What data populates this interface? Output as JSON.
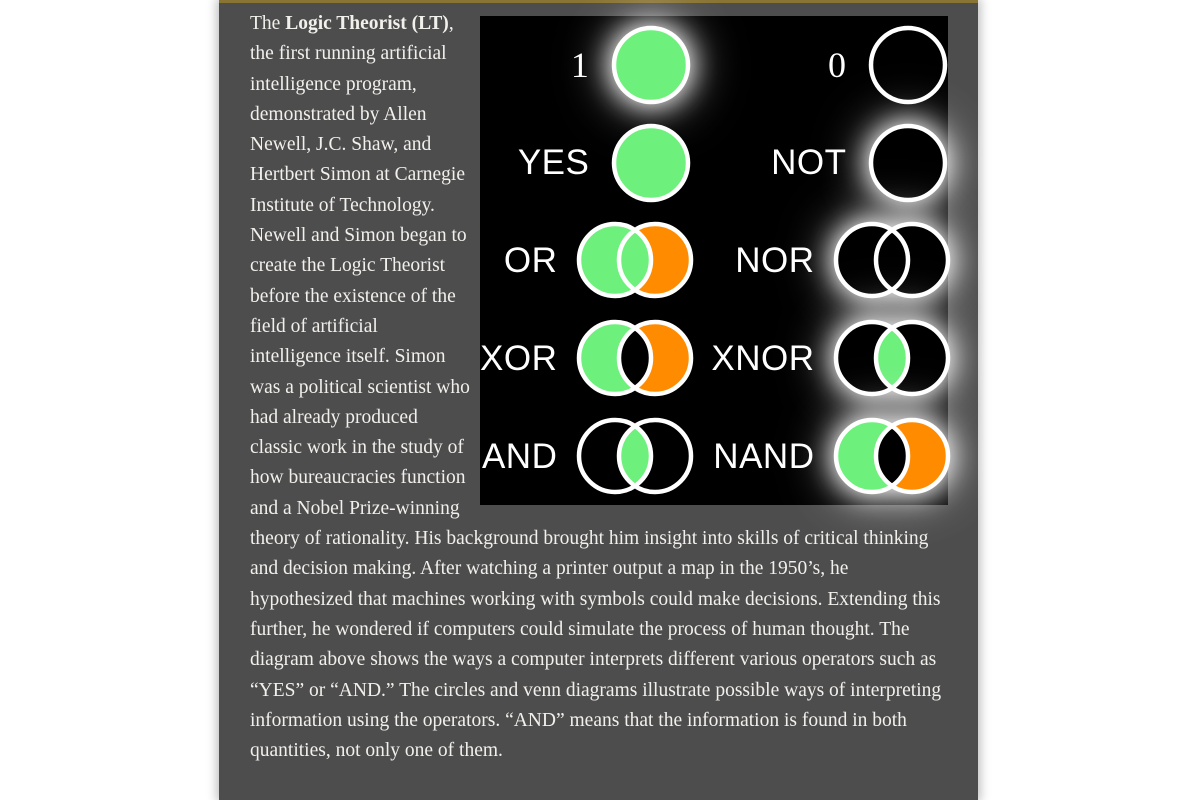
{
  "theme": {
    "page_background": "#ffffff",
    "article_background": "#4d4d4d",
    "top_rule": "#8a7434",
    "text_color": "#f2f0ec",
    "figure_background": "#000000",
    "on_color": "#6ef07d",
    "alt_color": "#ff8c00",
    "outline_color": "#ffffff",
    "glow_color": "#ffffff"
  },
  "article": {
    "intro": {
      "lead_prefix": "The ",
      "lead_bold": "Logic Theorist (LT)",
      "lead_rest": ", the first running artificial intelligence program, demonstrated by Allen Newell, J.C. Shaw, and Hertbert Simon at Carnegie Institute of Technology."
    },
    "body": "Newell and Simon began to create the Logic Theorist before the existence of the field of artificial intelligence itself. Simon was a political scientist who had already produced classic work in the study of how bureaucracies function and a Nobel Prize-winning theory of rationality. His background brought him insight into skills of critical thinking and decision making. After watching a printer output a map in the 1950’s, he hypothesized that machines working with symbols could make decisions. Extending this further, he wondered if computers could simulate the process of human thought. The diagram above shows the ways a computer interprets different various operators such as “YES” or “AND.” The circles and venn diagrams illustrate possible ways of interpreting information using the operators. “AND” means that the information is found in both quantities, not only one of them."
  },
  "figure": {
    "name": "logic-operator-diagram",
    "rows": [
      {
        "left": {
          "label": "1",
          "glyph": "circle",
          "fill": "on",
          "glow": true
        },
        "right": {
          "label": "0",
          "glyph": "circle",
          "fill": "off",
          "glow": false
        }
      },
      {
        "left": {
          "label": "YES",
          "glyph": "circle",
          "fill": "on",
          "glow": false
        },
        "right": {
          "label": "NOT",
          "glyph": "circle",
          "fill": "off",
          "glow": true
        }
      },
      {
        "left": {
          "label": "OR",
          "glyph": "venn",
          "left_fill": "on",
          "overlap_fill": "on",
          "right_fill": "alt",
          "glow": false
        },
        "right": {
          "label": "NOR",
          "glyph": "venn",
          "left_fill": "off",
          "overlap_fill": "off",
          "right_fill": "off",
          "glow": true
        }
      },
      {
        "left": {
          "label": "XOR",
          "glyph": "venn",
          "left_fill": "on",
          "overlap_fill": "off",
          "right_fill": "alt",
          "glow": false
        },
        "right": {
          "label": "XNOR",
          "glyph": "venn",
          "left_fill": "off",
          "overlap_fill": "on",
          "right_fill": "off",
          "glow": true
        }
      },
      {
        "left": {
          "label": "AND",
          "glyph": "venn",
          "left_fill": "off",
          "overlap_fill": "on",
          "right_fill": "off",
          "glow": false
        },
        "right": {
          "label": "NAND",
          "glyph": "venn",
          "left_fill": "on",
          "overlap_fill": "off",
          "right_fill": "alt",
          "glow": true
        }
      }
    ]
  }
}
